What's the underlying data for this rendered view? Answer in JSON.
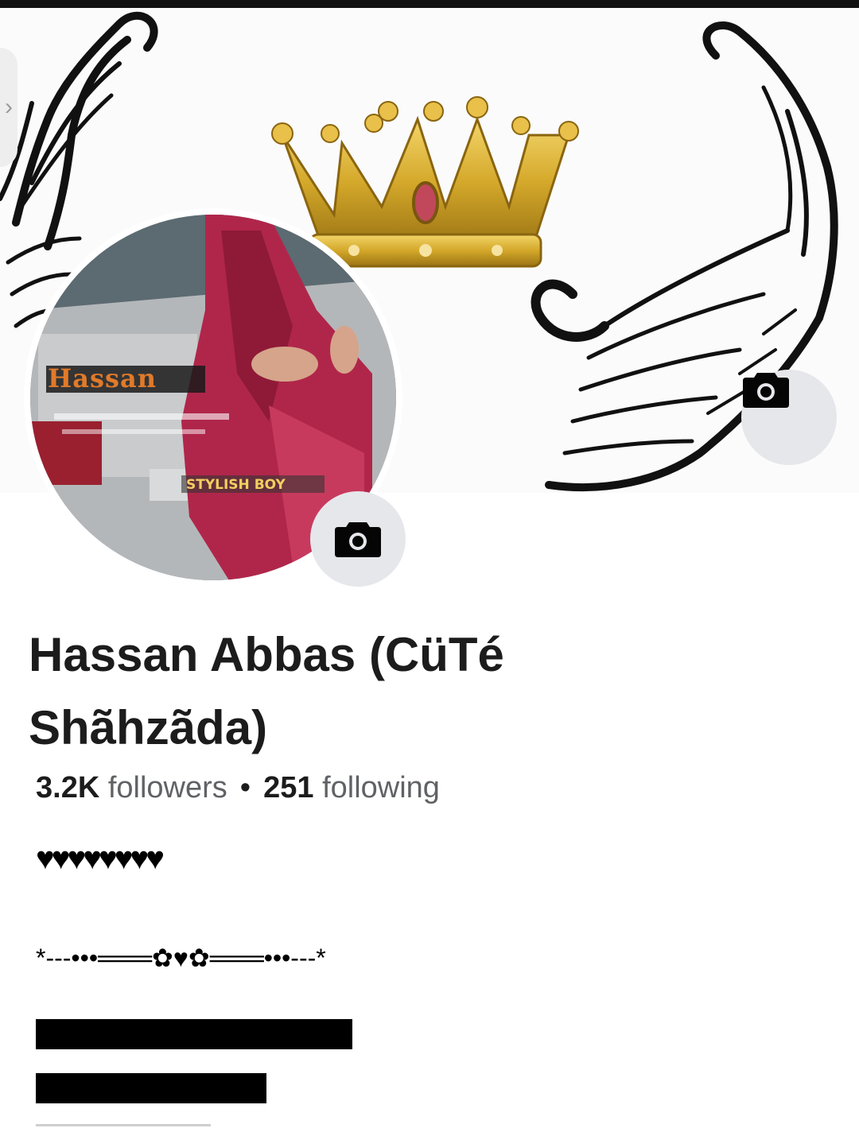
{
  "profile": {
    "name": "Hassan Abbas (CüTé Shãhzãda)",
    "followers_count": "3.2K",
    "followers_label": "followers",
    "separator": "•",
    "following_count": "251",
    "following_label": "following"
  },
  "bio": {
    "hearts": "♥♥♥♥♥♥♥♥",
    "divider": "*---•••═══✿♥✿═══•••---*"
  },
  "avatar": {
    "overlay_name": "Hassan",
    "overlay_tagline": "STYLISH BOY"
  },
  "cover": {
    "artwork": "crown-with-wings"
  },
  "icons": {
    "cover_camera": "camera-icon",
    "avatar_camera": "camera-icon",
    "side_chevron": "chevron-right-icon"
  },
  "colors": {
    "text_primary": "#1c1c1c",
    "text_secondary": "#606266",
    "camera_bg": "#e6e7eb",
    "crown_gold": "#d4a82a",
    "avatar_red": "#b0264a"
  }
}
